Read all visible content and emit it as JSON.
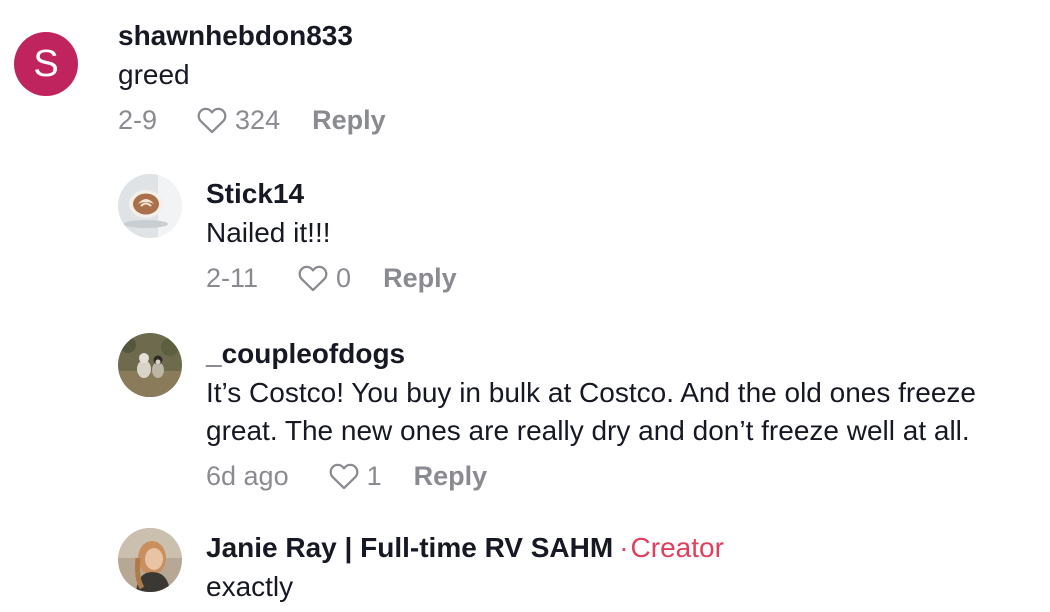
{
  "comments": [
    {
      "avatar_letter": "S",
      "avatar_color": "#c0245f",
      "username": "shawnhebdon833",
      "text": "greed",
      "date": "2-9",
      "likes": "324",
      "reply_label": "Reply"
    },
    {
      "username": "Stick14",
      "text": "Nailed it!!!",
      "date": "2-11",
      "likes": "0",
      "reply_label": "Reply"
    },
    {
      "username": "_coupleofdogs",
      "text_line1": "It’s Costco! You buy in bulk at Costco. And the old ones freeze",
      "text_line2": "great. The new ones are really dry and don’t freeze well at all.",
      "date": "6d ago",
      "likes": "1",
      "reply_label": "Reply"
    },
    {
      "username": "Janie Ray | Full-time RV SAHM",
      "separator": "·",
      "creator_label": "Creator",
      "text": "exactly"
    }
  ],
  "colors": {
    "text": "#161823",
    "meta": "#8a8b91",
    "creator": "#e0405e"
  }
}
